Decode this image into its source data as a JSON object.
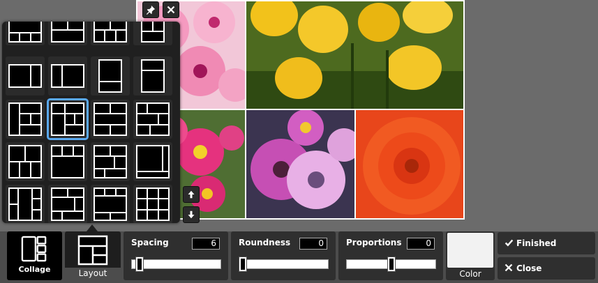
{
  "toolbar": {
    "collage_label": "Collage",
    "layout_label": "Layout",
    "spacing": {
      "label": "Spacing",
      "value": "6",
      "level": 0.05
    },
    "roundness": {
      "label": "Roundness",
      "value": "0",
      "level": 0.0
    },
    "proportions": {
      "label": "Proportions",
      "value": "0",
      "level": 0.5
    },
    "color_label": "Color",
    "color_value": "#f2f2f2",
    "finished_label": "Finished",
    "close_label": "Close"
  },
  "picker": {
    "selected_layout": 6,
    "pin_icon": "pin-icon",
    "close_icon": "close-icon",
    "scroll_up_icon": "arrow-up-icon",
    "scroll_down_icon": "arrow-down-icon"
  },
  "collage": {
    "photos": [
      "pink-flowers",
      "yellow-tulips",
      "pink-daisies",
      "purple-daisies",
      "orange-dahlia"
    ]
  },
  "colors": {
    "accent": "#5aa9ef",
    "panel": "#2f2f2f"
  }
}
